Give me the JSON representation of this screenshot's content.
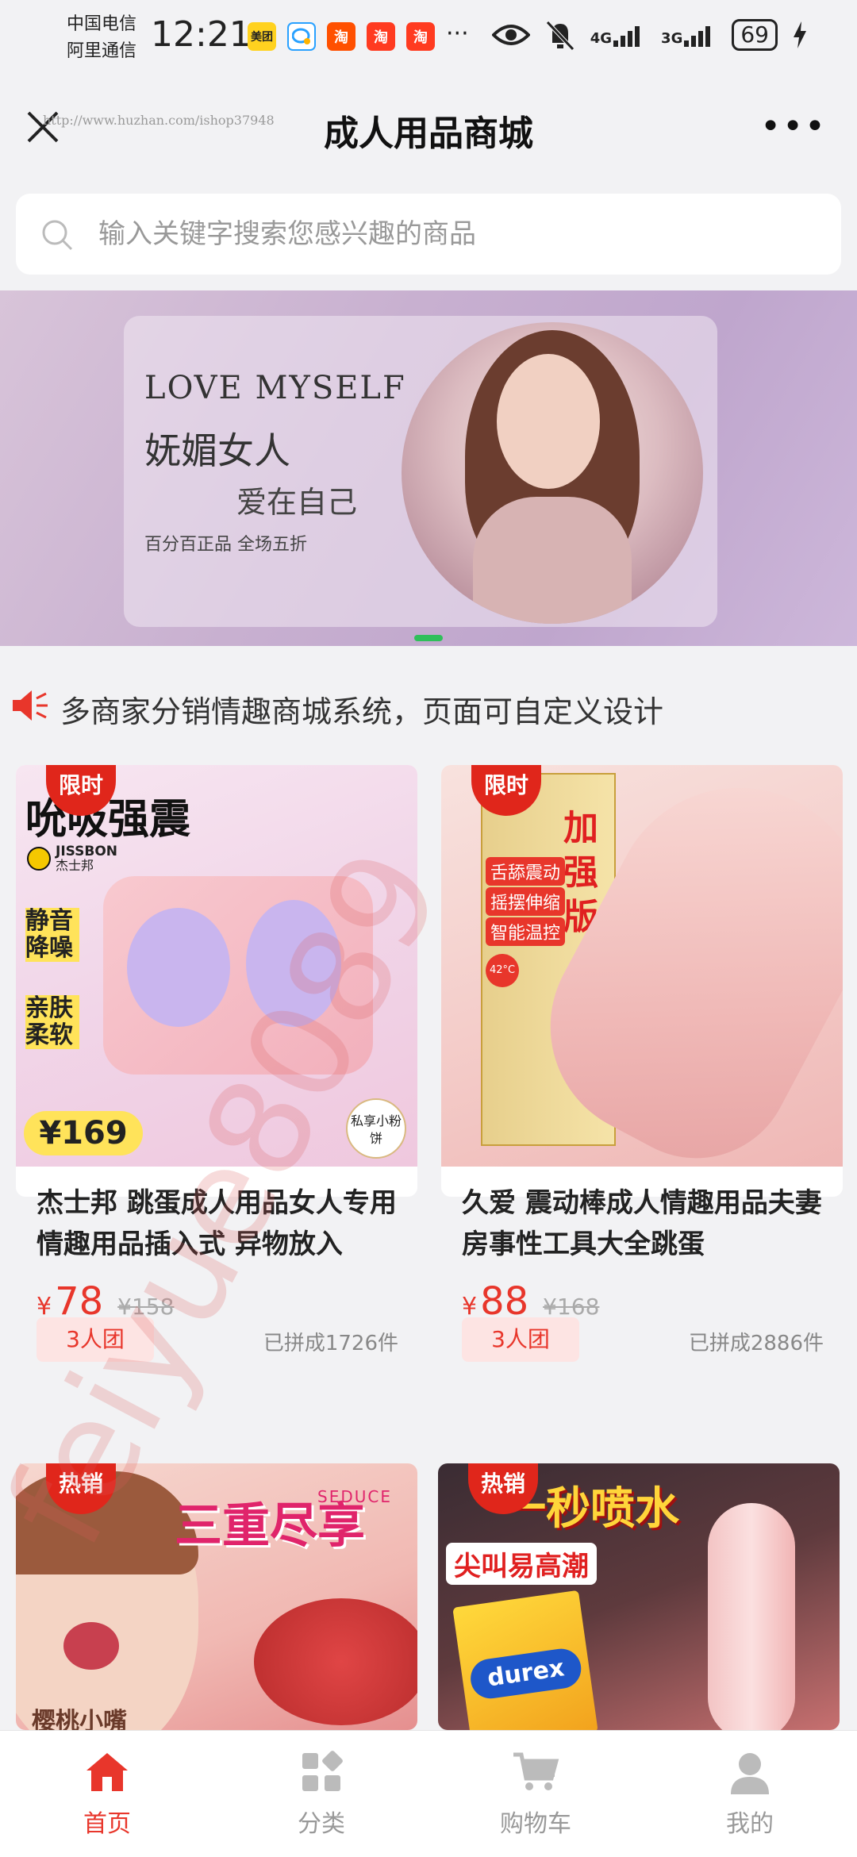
{
  "status_bar": {
    "carrier_1": "中国电信",
    "carrier_2": "阿里通信",
    "time": "12:21",
    "app_icons": [
      "美团",
      "",
      "淘",
      "淘",
      "淘"
    ],
    "more": "···",
    "network_1": "4G",
    "network_2": "3G",
    "battery": "69"
  },
  "nav": {
    "title": "成人用品商城",
    "watermark_url": "http://www.huzhan.com/ishop37948",
    "more": "•••"
  },
  "search": {
    "placeholder": "输入关键字搜索您感兴趣的商品"
  },
  "banner": {
    "en_title": "LOVE MYSELF",
    "cn_title": "妩媚女人",
    "cn_subtitle": "爱在自己",
    "small_text": "百分百正品 全场五折"
  },
  "notice": {
    "text": "多商家分销情趣商城系统，页面可自定义设计"
  },
  "products": [
    {
      "tag": "限时",
      "title": "杰士邦 跳蛋成人用品女人专用情趣用品插入式 异物放入",
      "price_symbol": "¥",
      "price": "78",
      "old_price": "¥158",
      "group": "3人团",
      "sold": "已拼成1726件",
      "image_text_1": "吮吸强震",
      "image_text_2": "JISSBON",
      "image_text_3": "杰士邦",
      "image_text_4": "静音降噪",
      "image_text_5": "亲肤柔软",
      "image_text_6": "¥169",
      "image_text_7": "私享小粉饼"
    },
    {
      "tag": "限时",
      "title": "久爱 震动棒成人情趣用品夫妻房事性工具大全跳蛋",
      "price_symbol": "¥",
      "price": "88",
      "old_price": "¥168",
      "group": "3人团",
      "sold": "已拼成2886件",
      "image_text_1": "加强版",
      "image_text_2": "舌舔震动",
      "image_text_3": "摇摆伸缩",
      "image_text_4": "智能温控",
      "image_text_5": "42°C"
    },
    {
      "tag": "热销",
      "image_text_1": "三重尽享",
      "image_text_2": "SEDUCE",
      "image_text_3": "樱桃小嘴"
    },
    {
      "tag": "热销",
      "image_text_1": "一秒喷水",
      "image_text_2": "尖叫易高潮",
      "image_text_3": "durex"
    }
  ],
  "tabs": [
    {
      "label": "首页",
      "icon": "home-icon",
      "active": true
    },
    {
      "label": "分类",
      "icon": "category-icon",
      "active": false
    },
    {
      "label": "购物车",
      "icon": "cart-icon",
      "active": false
    },
    {
      "label": "我的",
      "icon": "user-icon",
      "active": false
    }
  ],
  "watermark_text": "feiyue8089",
  "colors": {
    "accent": "#e8362b",
    "tag_red": "#e0261b",
    "background": "#f2f2f4"
  }
}
